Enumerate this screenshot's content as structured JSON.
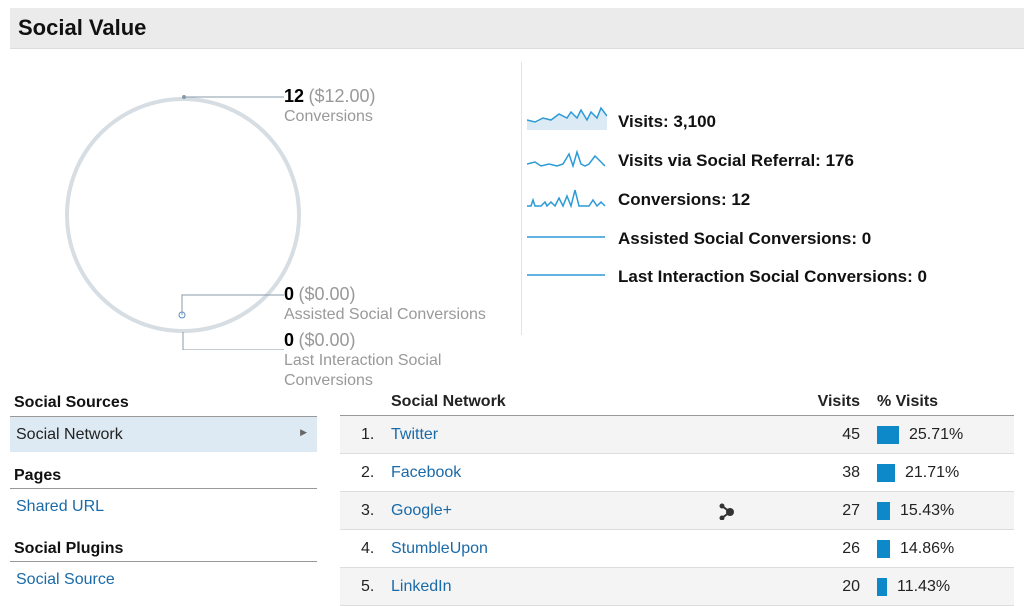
{
  "header": {
    "title": "Social Value"
  },
  "conversions": [
    {
      "value": "12",
      "money": "($12.00)",
      "label": "Conversions"
    },
    {
      "value": "0",
      "money": "($0.00)",
      "label": "Assisted Social Conversions"
    },
    {
      "value": "0",
      "money": "($0.00)",
      "label": "Last Interaction Social Conversions"
    }
  ],
  "metrics": [
    {
      "label": "Visits: 3,100"
    },
    {
      "label": "Visits via Social Referral: 176"
    },
    {
      "label": "Conversions: 12"
    },
    {
      "label": "Assisted Social Conversions: 0"
    },
    {
      "label": "Last Interaction Social Conversions: 0"
    }
  ],
  "sidebar": {
    "social_sources": "Social Sources",
    "social_network": "Social Network",
    "pages": "Pages",
    "shared_url": "Shared URL",
    "social_plugins": "Social Plugins",
    "social_source": "Social Source"
  },
  "table": {
    "headers": {
      "network": "Social Network",
      "visits": "Visits",
      "pct": "% Visits"
    },
    "rows": [
      {
        "num": "1.",
        "name": "Twitter",
        "visits": "45",
        "pct": "25.71%",
        "pct_value": 25.71
      },
      {
        "num": "2.",
        "name": "Facebook",
        "visits": "38",
        "pct": "21.71%",
        "pct_value": 21.71
      },
      {
        "num": "3.",
        "name": "Google+",
        "visits": "27",
        "pct": "15.43%",
        "pct_value": 15.43,
        "icon": "activity-stream-icon"
      },
      {
        "num": "4.",
        "name": "StumbleUpon",
        "visits": "26",
        "pct": "14.86%",
        "pct_value": 14.86
      },
      {
        "num": "5.",
        "name": "LinkedIn",
        "visits": "20",
        "pct": "11.43%",
        "pct_value": 11.43
      }
    ]
  },
  "colors": {
    "accent": "#0d88c8",
    "link": "#1a6aa8",
    "selected": "#dde9f3"
  }
}
